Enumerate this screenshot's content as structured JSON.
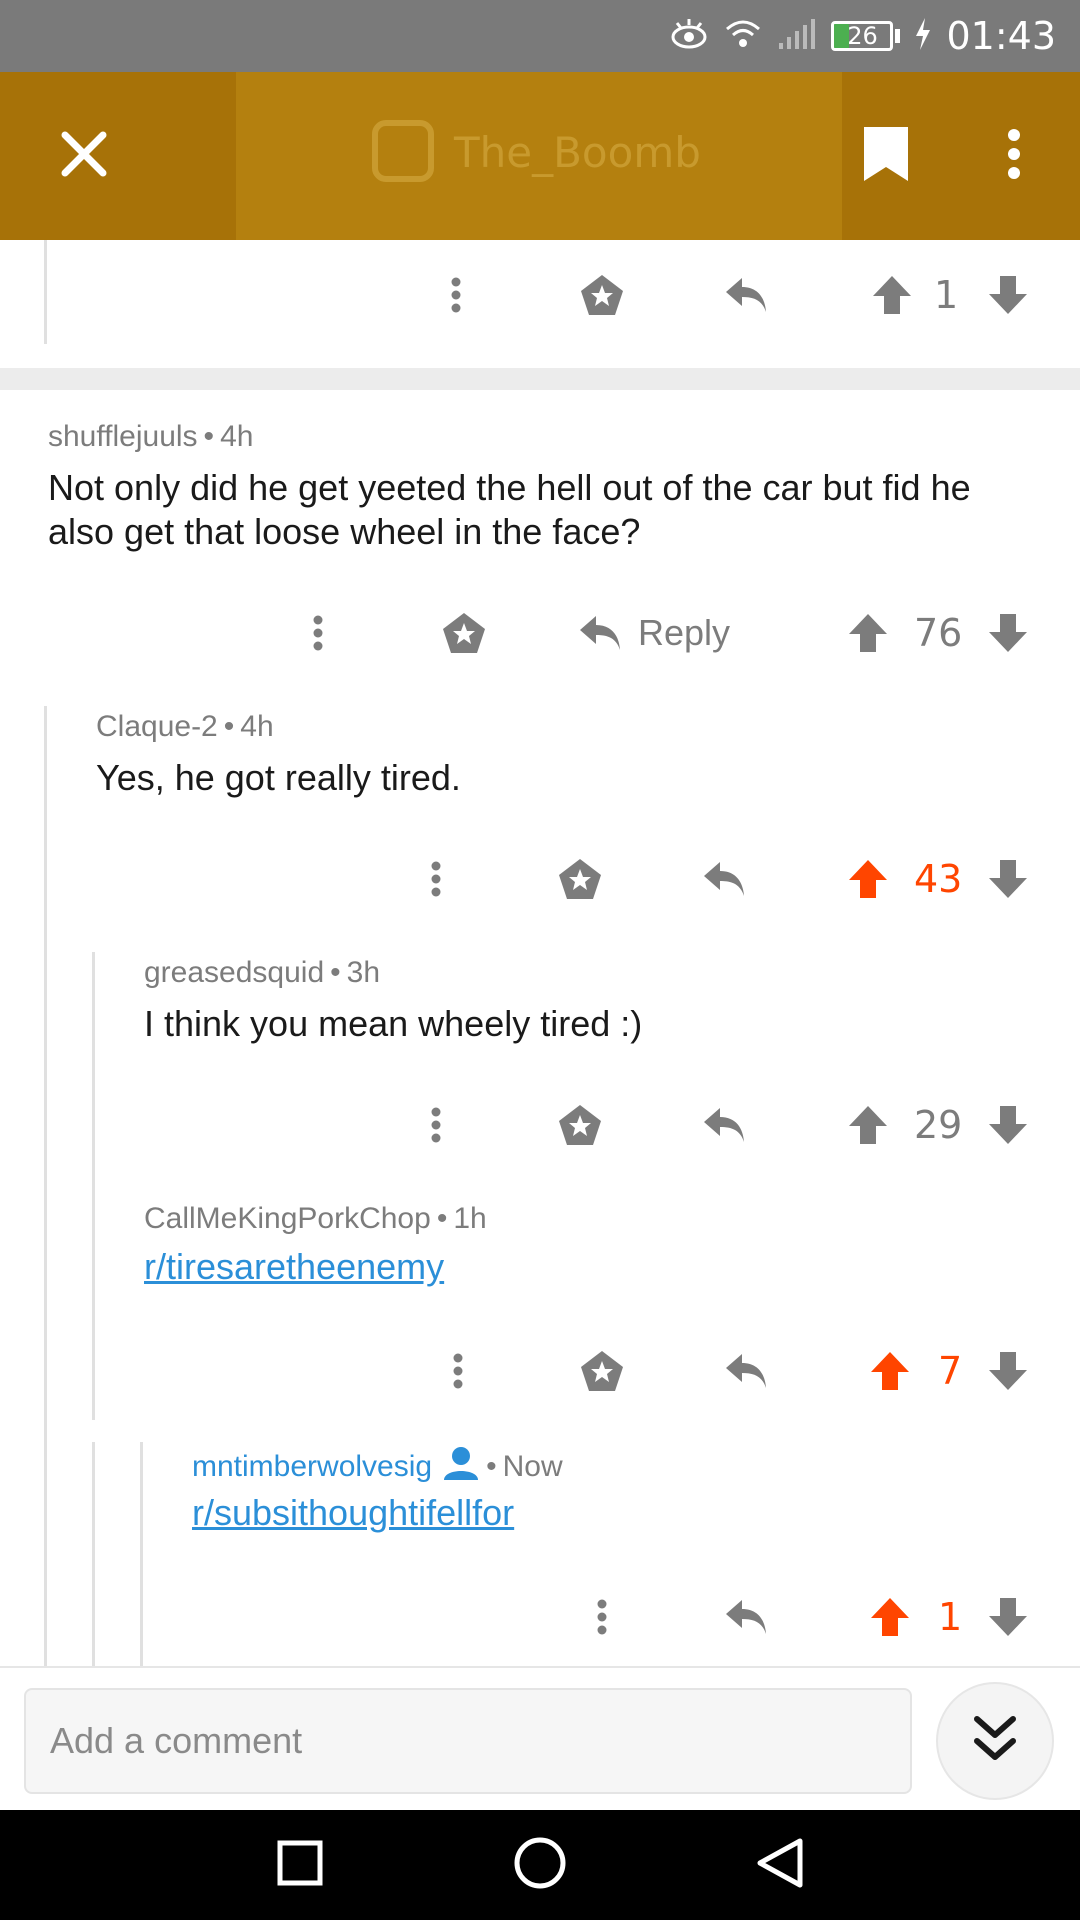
{
  "status_bar": {
    "time": "01:43",
    "battery": "26",
    "battery_level": 0.26
  },
  "header": {
    "media_title": "The_Boomb"
  },
  "top_action": {
    "vote_count": "1"
  },
  "comments": [
    {
      "author": "shufflejuuls",
      "age": "4h",
      "body": "Not only did he get yeeted the hell out of the car but fid he also get that loose wheel in the face?",
      "reply_label": "Reply",
      "votes": "76",
      "upvoted": false
    },
    {
      "author": "Claque-2",
      "age": "4h",
      "body": "Yes, he got really tired.",
      "votes": "43",
      "upvoted": true
    },
    {
      "author": "greasedsquid",
      "age": "3h",
      "body": "I think you mean wheely tired :)",
      "votes": "29",
      "upvoted": false
    },
    {
      "author": "CallMeKingPorkChop",
      "age": "1h",
      "link": "r/tiresaretheenemy",
      "votes": "7",
      "upvoted": true
    },
    {
      "author": "mntimberwolvesig",
      "age": "Now",
      "link": "r/subsithoughtifellfor",
      "votes": "1",
      "upvoted": true
    }
  ],
  "composer": {
    "placeholder": "Add a comment"
  },
  "colors": {
    "header": "#a77208",
    "upvote": "#ff4500",
    "link": "#2b8fd8",
    "icon": "#7c7c7c"
  }
}
